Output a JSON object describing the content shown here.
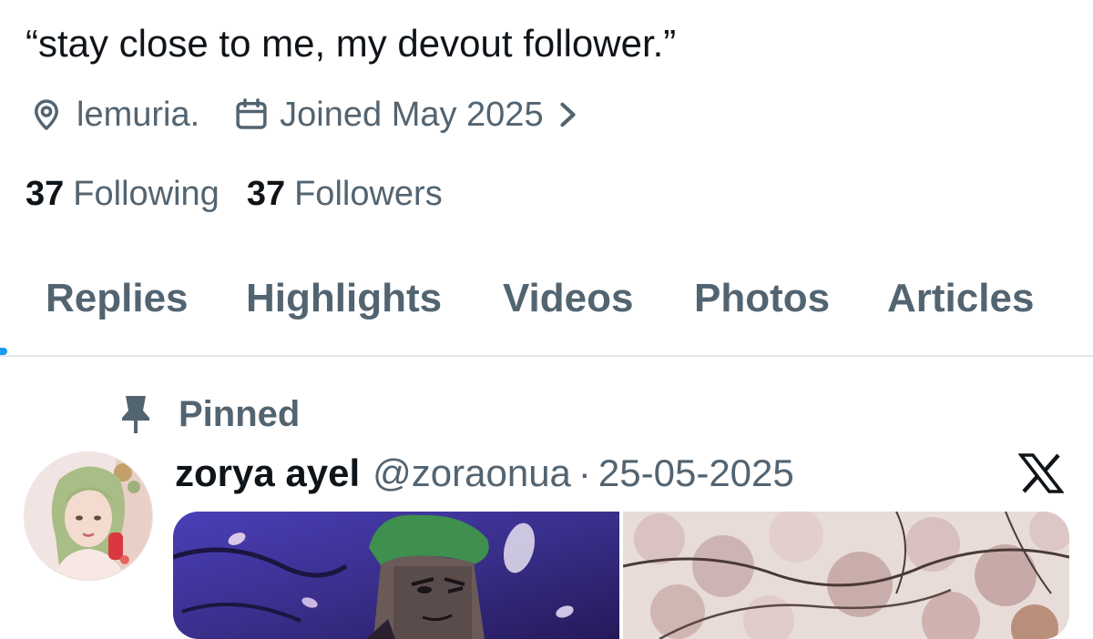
{
  "profile": {
    "bio": "“stay close to me, my devout follower.”",
    "location": "lemuria.",
    "joined": "Joined May 2025",
    "following_count": "37",
    "following_label": "Following",
    "followers_count": "37",
    "followers_label": "Followers"
  },
  "tabs": [
    {
      "label": "Replies"
    },
    {
      "label": "Highlights"
    },
    {
      "label": "Videos"
    },
    {
      "label": "Photos"
    },
    {
      "label": "Articles"
    }
  ],
  "pinned": {
    "label": "Pinned"
  },
  "tweet": {
    "author_name": "zorya ayel",
    "handle": "@zoraonua",
    "separator": "·",
    "date": "25-05-2025"
  },
  "icons": {
    "location": "location-pin-icon",
    "calendar": "calendar-icon",
    "chevron": "chevron-right-icon",
    "pin": "pin-icon",
    "x_logo": "x-logo-icon"
  },
  "colors": {
    "text_primary": "#0f1419",
    "text_secondary": "#536471",
    "accent": "#1d9bf0",
    "divider": "#e3e8ec"
  }
}
